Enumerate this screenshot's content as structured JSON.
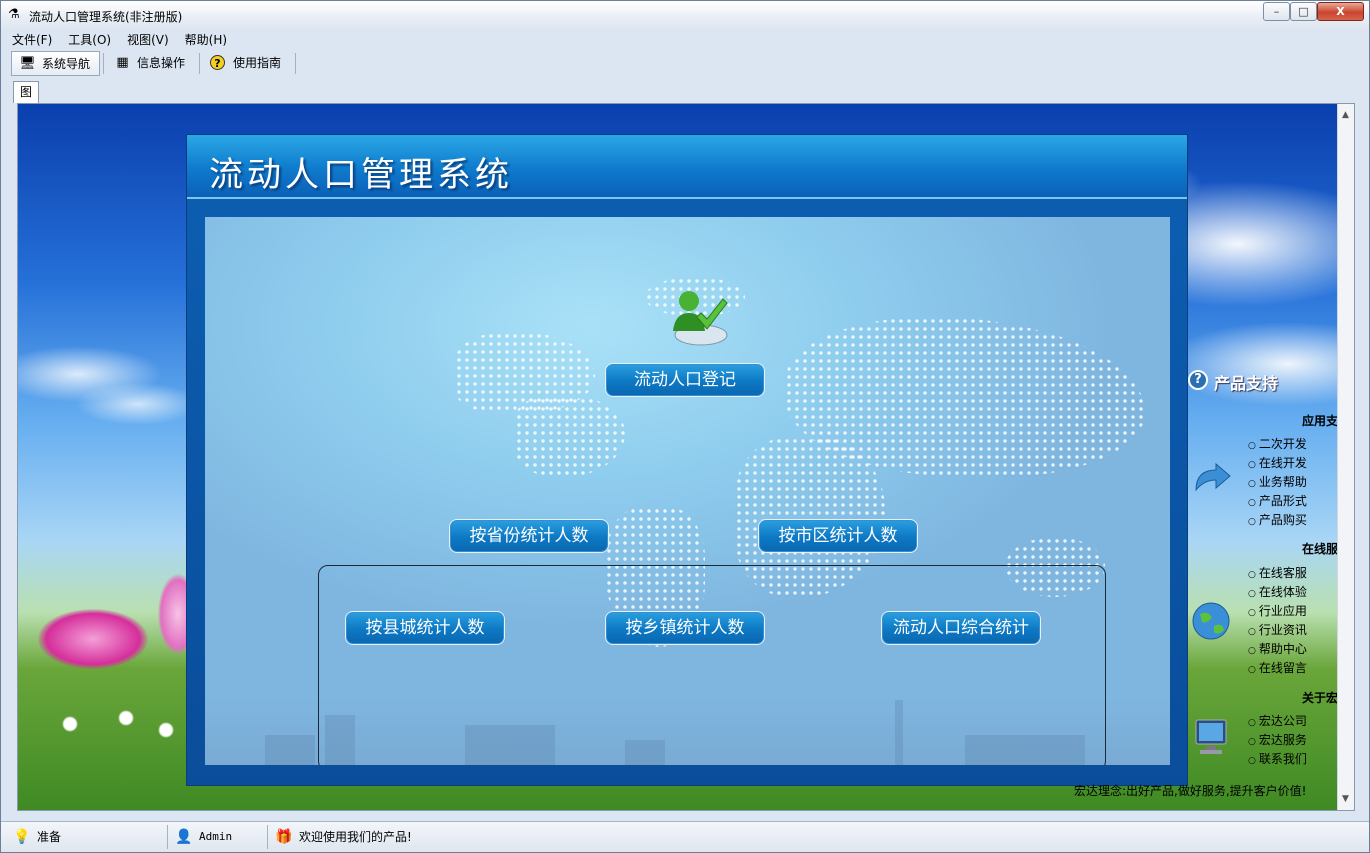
{
  "window": {
    "title": "流动人口管理系统(非注册版)",
    "controls": {
      "minimize": "–",
      "maximize": "□",
      "close": "X"
    }
  },
  "menu": [
    "文件(F)",
    "工具(O)",
    "视图(V)",
    "帮助(H)"
  ],
  "toolbar": [
    {
      "label": "系统导航",
      "icon": "monitor-icon",
      "active": true
    },
    {
      "label": "信息操作",
      "icon": "grid-icon",
      "active": false
    },
    {
      "label": "使用指南",
      "icon": "help-icon",
      "active": false
    }
  ],
  "tabs": [
    "图文导航"
  ],
  "panel": {
    "title": "流动人口管理系统",
    "register_button": "流动人口登记",
    "stats_buttons": [
      "按省份统计人数",
      "按市区统计人数",
      "按县城统计人数",
      "按乡镇统计人数",
      "流动人口综合统计"
    ]
  },
  "side": {
    "heading": "产品支持",
    "sections": [
      {
        "title": "应用支持",
        "links": [
          "二次开发",
          "在线开发",
          "业务帮助",
          "产品形式",
          "产品购买"
        ]
      },
      {
        "title": "在线服务",
        "links": [
          "在线客服",
          "在线体验",
          "行业应用",
          "行业资讯",
          "帮助中心",
          "在线留言"
        ]
      },
      {
        "title": "关于宏达",
        "links": [
          "宏达公司",
          "宏达服务",
          "联系我们"
        ]
      }
    ],
    "slogan": "宏达理念:出好产品,做好服务,提升客户价值!"
  },
  "statusbar": {
    "status": "准备",
    "user": "Admin",
    "message": "欢迎使用我们的产品!"
  },
  "colors": {
    "panel_blue": "#0a61b8",
    "button_blue": "#0d78c4",
    "close_red": "#c9452c"
  }
}
